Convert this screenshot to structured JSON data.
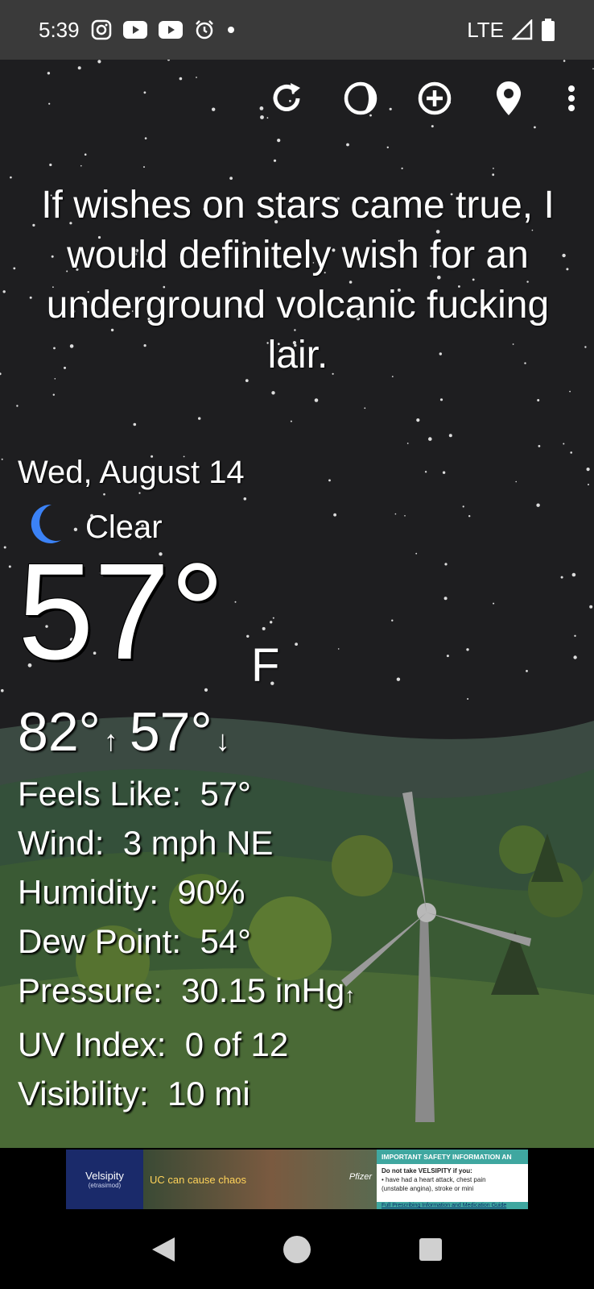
{
  "status_bar": {
    "time": "5:39",
    "icons_left": [
      "instagram-icon",
      "youtube-icon",
      "youtube-icon",
      "alarm-icon",
      "dot-icon"
    ],
    "network": "LTE",
    "icons_right": [
      "signal-icon",
      "battery-icon"
    ]
  },
  "toolbar": {
    "buttons": [
      "refresh-icon",
      "theme-icon",
      "add-location-icon",
      "location-pin-icon",
      "more-vert-icon"
    ]
  },
  "quote": "If wishes on stars came true, I would definitely wish for an underground volcanic fucking lair.",
  "weather": {
    "date": "Wed, August 14",
    "condition": "Clear",
    "condition_icon": "moon-icon",
    "temperature": "57°",
    "unit": "F",
    "high": "82°",
    "high_arrow": "↑",
    "low": "57°",
    "low_arrow": "↓",
    "details": {
      "feels_like_label": "Feels Like:",
      "feels_like": "57°",
      "wind_label": "Wind:",
      "wind": "3 mph NE",
      "humidity_label": "Humidity:",
      "humidity": "90%",
      "dew_point_label": "Dew Point:",
      "dew_point": "54°",
      "pressure_label": "Pressure:",
      "pressure": "30.15 inHg",
      "pressure_arrow": "↑",
      "uv_label": "UV Index:",
      "uv": "0 of 12",
      "visibility_label": "Visibility:",
      "visibility": "10 mi"
    }
  },
  "ad": {
    "brand": "Velsipity",
    "brand_sub": "(etrasimod)",
    "tagline": "UC can cause chaos",
    "sponsor": "Pfizer",
    "safety_header": "IMPORTANT SAFETY INFORMATION AN",
    "safety_line1": "Do not take VELSIPITY if you:",
    "safety_line2": "• have had a heart attack, chest pain",
    "safety_line3": "(unstable angina), stroke or mini",
    "footer": "Full Prescribing Information and Medication Guide"
  },
  "colors": {
    "sky": "#1e1e20",
    "hills": "#2e4a2e",
    "moon": "#3b82f6",
    "status_bar": "#3a3a3a"
  }
}
